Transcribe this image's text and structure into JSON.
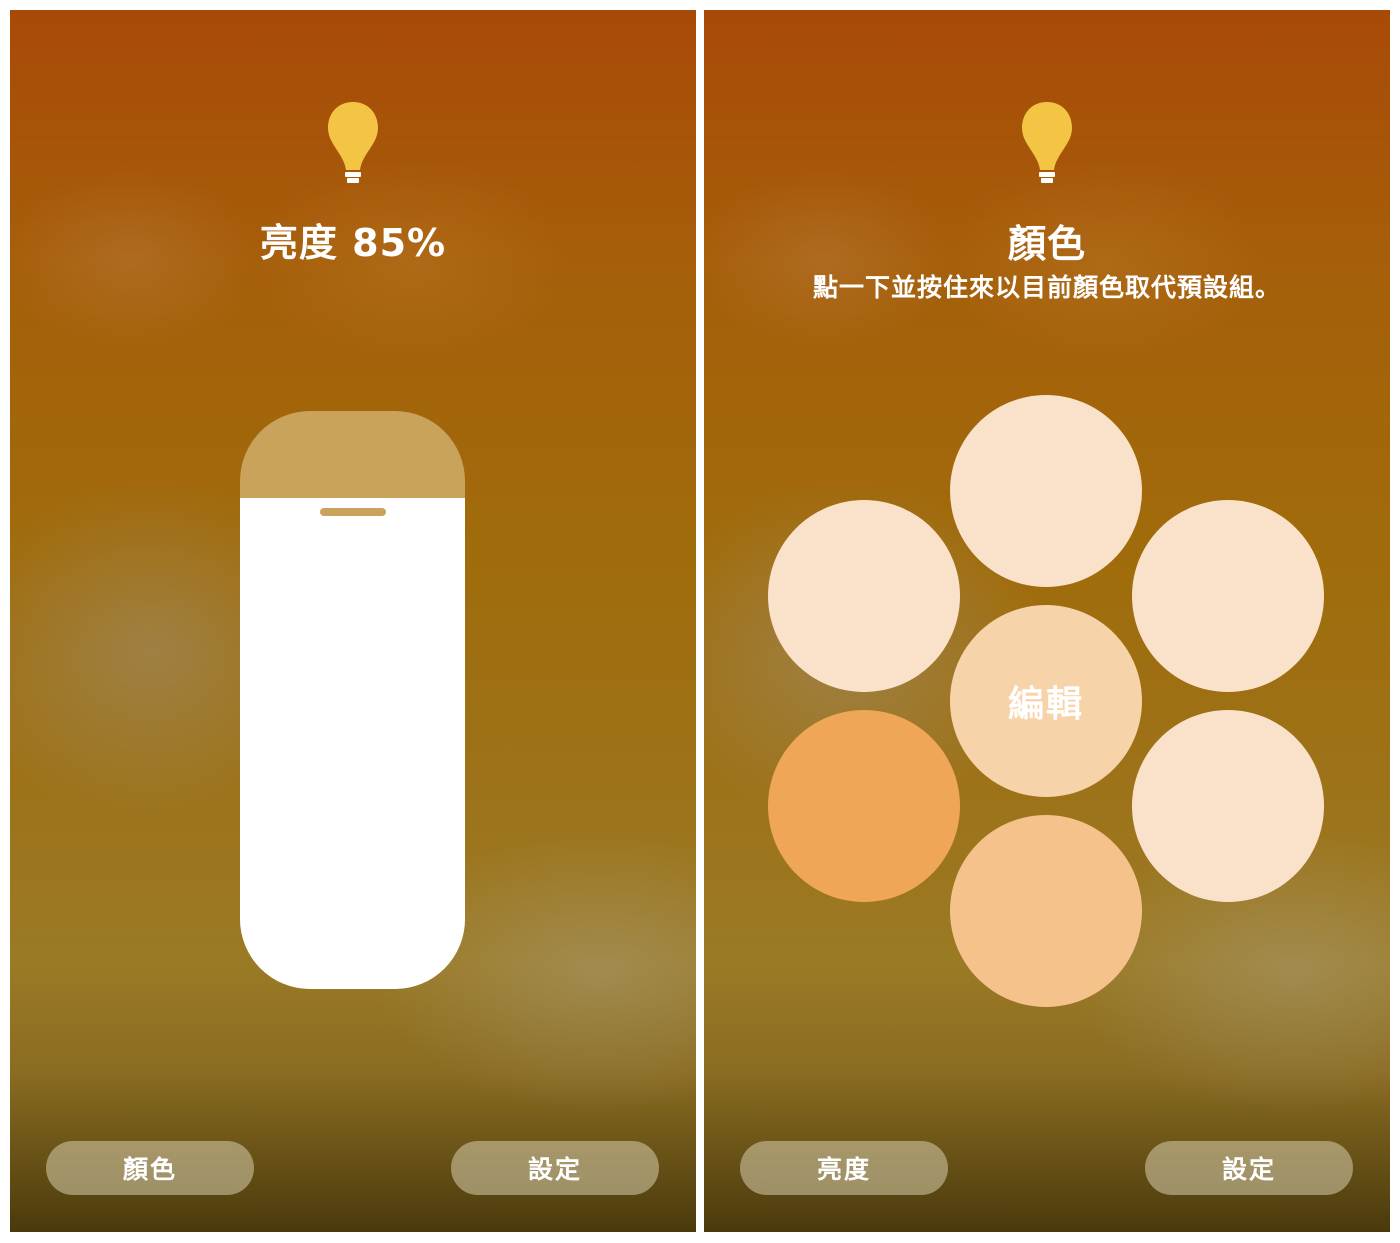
{
  "brightness_screen": {
    "title": "亮度 85%",
    "brightness_level": 0.85,
    "icon": "lightbulb-icon",
    "bottom_buttons": {
      "left_label": "顏色",
      "right_label": "設定"
    }
  },
  "color_screen": {
    "title": "顏色",
    "subtitle": "點一下並按住來以目前顏色取代預設組。",
    "icon": "lightbulb-icon",
    "center_label": "編輯",
    "swatches": [
      {
        "position": "top",
        "color": "#fae2ca"
      },
      {
        "position": "upper-left",
        "color": "#fae2ca"
      },
      {
        "position": "upper-right",
        "color": "#fae2ca"
      },
      {
        "position": "center",
        "color": "#f6d3a9"
      },
      {
        "position": "lower-left",
        "color": "#f0a657"
      },
      {
        "position": "lower-right",
        "color": "#fae2ca"
      },
      {
        "position": "bottom",
        "color": "#f6c28b"
      }
    ],
    "bottom_buttons": {
      "left_label": "亮度",
      "right_label": "設定"
    }
  },
  "colors": {
    "bulb": "#f4c545",
    "slider_track": "#c9a25c",
    "slider_fill": "#ffffff"
  }
}
